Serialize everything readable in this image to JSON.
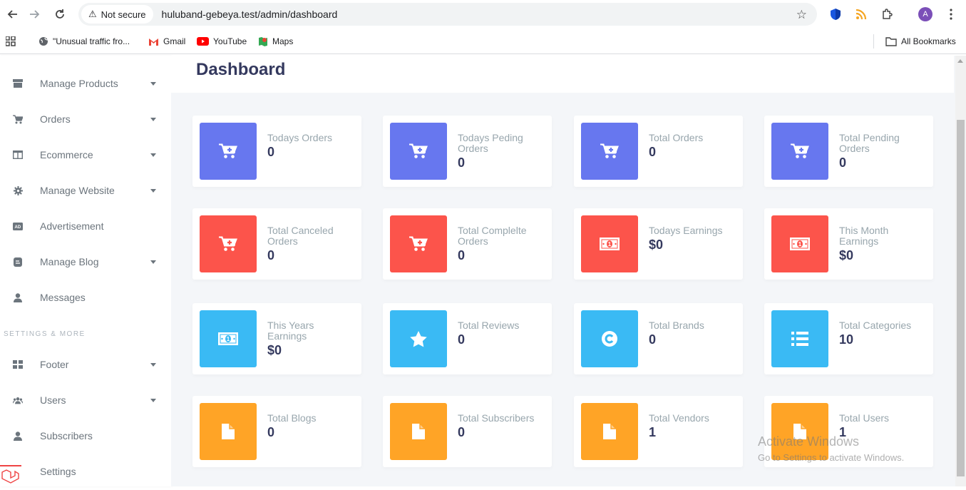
{
  "browser": {
    "security_label": "Not secure",
    "url": "huluband-gebeya.test/admin/dashboard",
    "profile_initial": "A",
    "bookmarks": [
      {
        "label": "\"Unusual traffic fro...",
        "icon": "globe-icon"
      },
      {
        "label": "Gmail",
        "icon": "gmail-icon"
      },
      {
        "label": "YouTube",
        "icon": "youtube-icon"
      },
      {
        "label": "Maps",
        "icon": "maps-icon"
      }
    ],
    "all_bookmarks": "All Bookmarks"
  },
  "sidebar": {
    "items": [
      {
        "label": "Manage Products",
        "icon": "box-icon",
        "dropdown": true
      },
      {
        "label": "Orders",
        "icon": "cart-icon",
        "dropdown": true
      },
      {
        "label": "Ecommerce",
        "icon": "columns-icon",
        "dropdown": true
      },
      {
        "label": "Manage Website",
        "icon": "gear-icon",
        "dropdown": true
      },
      {
        "label": "Advertisement",
        "icon": "ad-icon",
        "dropdown": false
      },
      {
        "label": "Manage Blog",
        "icon": "blog-icon",
        "dropdown": true
      },
      {
        "label": "Messages",
        "icon": "user-icon",
        "dropdown": false
      }
    ],
    "section_label": "SETTINGS & MORE",
    "settings_items": [
      {
        "label": "Footer",
        "icon": "grid-icon",
        "dropdown": true
      },
      {
        "label": "Users",
        "icon": "users-icon",
        "dropdown": true
      },
      {
        "label": "Subscribers",
        "icon": "user-icon",
        "dropdown": false
      },
      {
        "label": "Settings",
        "icon": "gear-icon",
        "dropdown": false
      }
    ]
  },
  "main": {
    "title": "Dashboard",
    "colors": {
      "blue": "#6777ef",
      "red": "#fc544b",
      "cyan": "#3abaf4",
      "orange": "#ffa426"
    },
    "cards": [
      {
        "label": "Todays Orders",
        "value": "0",
        "icon": "cart-plus-icon",
        "color": "#6777ef"
      },
      {
        "label": "Todays Peding Orders",
        "value": "0",
        "icon": "cart-plus-icon",
        "color": "#6777ef"
      },
      {
        "label": "Total Orders",
        "value": "0",
        "icon": "cart-plus-icon",
        "color": "#6777ef"
      },
      {
        "label": "Total Pending Orders",
        "value": "0",
        "icon": "cart-plus-icon",
        "color": "#6777ef"
      },
      {
        "label": "Total Canceled Orders",
        "value": "0",
        "icon": "cart-plus-icon",
        "color": "#fc544b"
      },
      {
        "label": "Total Complelte Orders",
        "value": "0",
        "icon": "cart-plus-icon",
        "color": "#fc544b"
      },
      {
        "label": "Todays Earnings",
        "value": "$0",
        "icon": "money-bill-icon",
        "color": "#fc544b"
      },
      {
        "label": "This Month Earnings",
        "value": "$0",
        "icon": "money-bill-icon",
        "color": "#fc544b"
      },
      {
        "label": "This Years Earnings",
        "value": "$0",
        "icon": "money-bill-icon",
        "color": "#3abaf4"
      },
      {
        "label": "Total Reviews",
        "value": "0",
        "icon": "star-icon",
        "color": "#3abaf4"
      },
      {
        "label": "Total Brands",
        "value": "0",
        "icon": "copyright-icon",
        "color": "#3abaf4"
      },
      {
        "label": "Total Categories",
        "value": "10",
        "icon": "list-icon",
        "color": "#3abaf4"
      },
      {
        "label": "Total Blogs",
        "value": "0",
        "icon": "file-icon",
        "color": "#ffa426"
      },
      {
        "label": "Total Subscribers",
        "value": "0",
        "icon": "file-icon",
        "color": "#ffa426"
      },
      {
        "label": "Total Vendors",
        "value": "1",
        "icon": "file-icon",
        "color": "#ffa426"
      },
      {
        "label": "Total Users",
        "value": "1",
        "icon": "file-icon",
        "color": "#ffa426"
      }
    ]
  },
  "watermark": {
    "title": "Activate Windows",
    "subtitle": "Go to Settings to activate Windows."
  }
}
